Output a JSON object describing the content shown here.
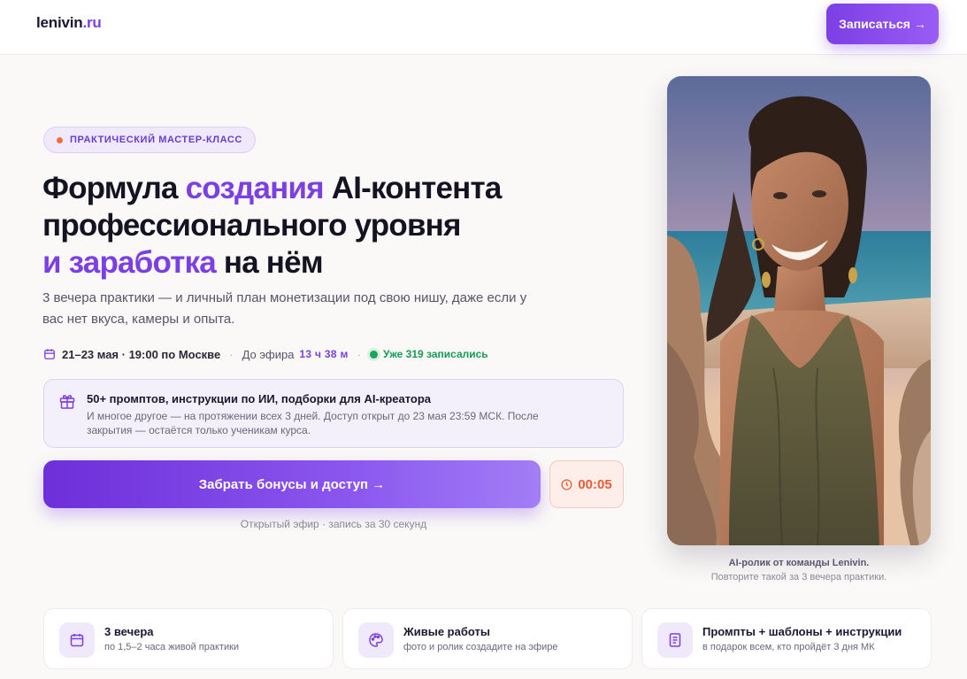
{
  "header": {
    "logo_main": "lenivin",
    "logo_tld": ".ru",
    "cta_label": "Записаться →"
  },
  "hero": {
    "badge": "ПРАКТИЧЕСКИЙ МАСТЕР-КЛАСС",
    "title_part1": "Формула ",
    "title_accent1": "создания",
    "title_part2": " AI-контента профессионального уровня",
    "title_accent2": "и заработка",
    "title_part3": " на нём",
    "subtitle": "3 вечера практики — и личный план монетизации под свою нишу, даже если у вас нет вкуса, камеры и опыта."
  },
  "meta": {
    "date": "21–23 мая · 19:00 по Москве",
    "separator": "·",
    "until_label": "До эфира",
    "countdown": "13 ч 38 м",
    "signed_up": "Уже 319 записались"
  },
  "bonus": {
    "title": "50+ промптов, инструкции по ИИ, подборки для AI-креатора",
    "text": "И многое другое — на протяжении всех 3 дней. Доступ открыт до 23 мая 23:59 МСК. После закрытия — остаётся только ученикам курса."
  },
  "cta": {
    "main_label": "Забрать бонусы и доступ →",
    "timer": "00:05",
    "caption": "Открытый эфир · запись за 30 секунд"
  },
  "photo": {
    "caption_title": "AI-ролик от команды Lenivin.",
    "caption_sub": "Повторите такой за 3 вечера практики."
  },
  "features": [
    {
      "icon": "calendar-icon",
      "title": "3 вечера",
      "sub": "по 1,5–2 часа живой практики"
    },
    {
      "icon": "palette-icon",
      "title": "Живые работы",
      "sub": "фото и ролик создадите на эфире"
    },
    {
      "icon": "book-icon",
      "title": "Промпты + шаблоны + инструкции",
      "sub": "в подарок всем, кто пройдёт 3 дня МК"
    }
  ],
  "colors": {
    "accent": "#7b3fe4",
    "success": "#1a9a55",
    "timer": "#ea5b34"
  }
}
